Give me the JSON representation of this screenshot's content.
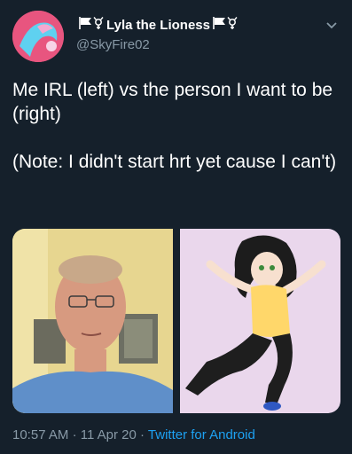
{
  "tweet": {
    "display_name": "Lyla the Lioness",
    "handle": "@SkyFire02",
    "text": "Me IRL (left) vs the person I want to be (right)\n\n(Note: I didn't start hrt yet cause I can't)",
    "time": "10:57 AM",
    "separator": "·",
    "date": "11 Apr 20",
    "source": "Twitter for Android"
  },
  "icons": {
    "name_prefix": "transgender-flag-icon",
    "name_suffix": "transgender-flag-icon",
    "menu": "chevron-down-icon"
  },
  "colors": {
    "background": "#15202b",
    "secondary_text": "#8899a6",
    "link": "#1da1f2"
  }
}
